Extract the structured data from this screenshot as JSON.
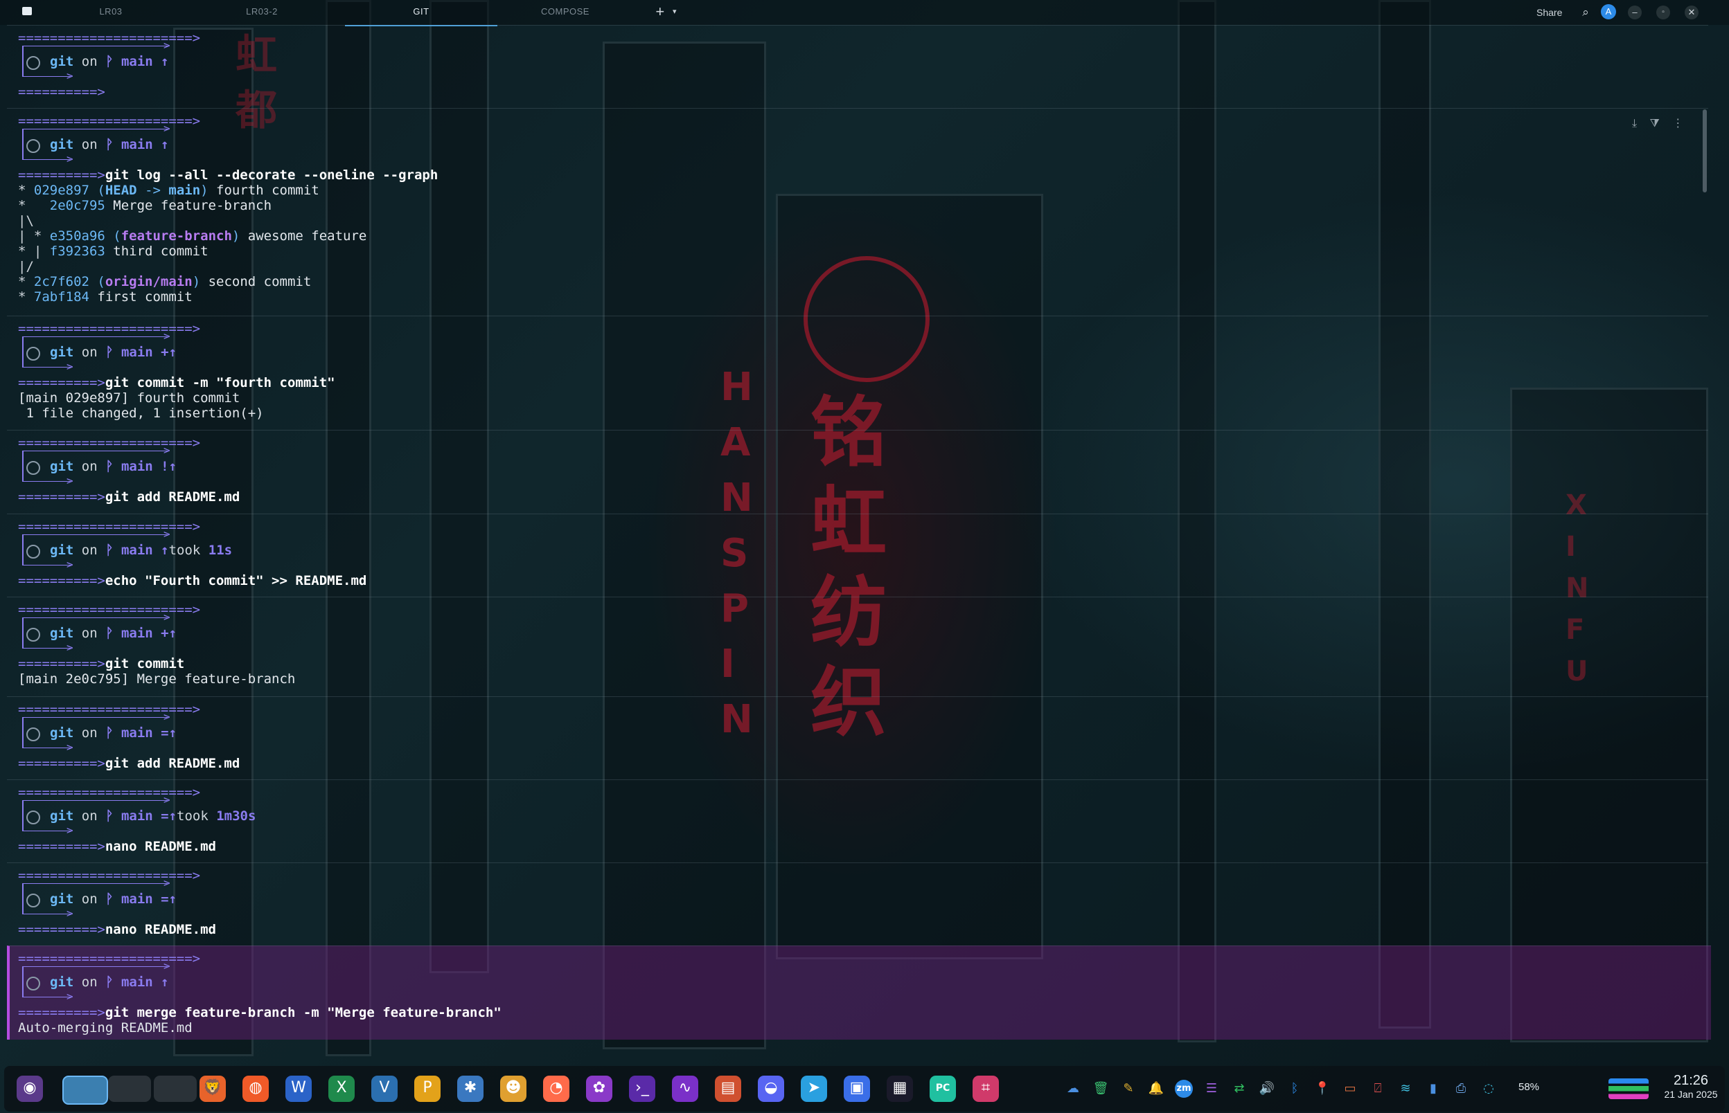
{
  "window": {
    "tabs": [
      "LR03",
      "LR03-2",
      "GIT",
      "COMPOSE"
    ],
    "active_tab": "GIT",
    "new_tab_label": "+",
    "share_label": "Share",
    "avatar_initial": "A"
  },
  "prompt": {
    "separator_long": "======================>",
    "separator_short": "==========>",
    "repo": "git",
    "on": "on",
    "branch_icon": "ᚹ",
    "branch": "main"
  },
  "blocks": [
    {
      "status": "↑",
      "took": "",
      "command": "",
      "output": []
    },
    {
      "status": "↑",
      "took": "",
      "command": "git log --all --decorate --oneline --graph",
      "output": [
        "* 029e897 (HEAD -> main) fourth commit",
        "*   2e0c795 Merge feature-branch",
        "|\\",
        "| * e350a96 (feature-branch) awesome feature",
        "* | f392363 third commit",
        "|/",
        "* 2c7f602 (origin/main) second commit",
        "* 7abf184 first commit"
      ]
    },
    {
      "status": "+↑",
      "took": "",
      "command": "git commit -m \"fourth commit\"",
      "output": [
        "[main 029e897] fourth commit",
        " 1 file changed, 1 insertion(+)"
      ]
    },
    {
      "status": "!↑",
      "took": "",
      "command": "git add README.md",
      "output": []
    },
    {
      "status": "↑",
      "took": "11s",
      "command": "echo \"Fourth commit\" >> README.md",
      "output": []
    },
    {
      "status": "+↑",
      "took": "",
      "command": "git commit",
      "output": [
        "[main 2e0c795] Merge feature-branch"
      ]
    },
    {
      "status": "=↑",
      "took": "",
      "command": "git add README.md",
      "output": []
    },
    {
      "status": "=↑",
      "took": "1m30s",
      "command": "nano README.md",
      "output": []
    },
    {
      "status": "=↑",
      "took": "",
      "command": "nano README.md",
      "output": []
    },
    {
      "status": "↑",
      "took": "",
      "command": "git merge feature-branch -m \"Merge feature-branch\"",
      "output": [
        "Auto-merging README.md"
      ]
    }
  ],
  "git_log": {
    "commits": [
      {
        "graph": "* ",
        "hash": "029e897",
        "refs": [
          "HEAD -> main"
        ],
        "message": "fourth commit"
      },
      {
        "graph": "*   ",
        "hash": "2e0c795",
        "refs": [],
        "message": "Merge feature-branch"
      },
      {
        "graph": "| * ",
        "hash": "e350a96",
        "refs": [
          "feature-branch"
        ],
        "message": "awesome feature"
      },
      {
        "graph": "* | ",
        "hash": "f392363",
        "refs": [],
        "message": "third commit"
      },
      {
        "graph": "* ",
        "hash": "2c7f602",
        "refs": [
          "origin/main"
        ],
        "message": "second commit"
      },
      {
        "graph": "* ",
        "hash": "7abf184",
        "refs": [],
        "message": "first commit"
      }
    ]
  },
  "taskbar": {
    "apps": [
      "launcher",
      "workspace-1",
      "workspace-2",
      "workspace-3",
      "brave",
      "firefox",
      "word",
      "excel",
      "visio",
      "powerpoint",
      "arc",
      "smiley",
      "pie",
      "flower",
      "terminal",
      "wave",
      "folder",
      "discord",
      "telegram",
      "teams",
      "store",
      "pycharm",
      "snip"
    ],
    "tray": [
      "cloud",
      "trash",
      "notes",
      "bell",
      "zoom",
      "db",
      "switch",
      "volume",
      "bluetooth",
      "pin",
      "layers",
      "mute",
      "wifi",
      "battery",
      "printer",
      "spinner"
    ],
    "battery_label": "58%",
    "clock_time": "21:26",
    "clock_date": "21 Jan 2025"
  }
}
